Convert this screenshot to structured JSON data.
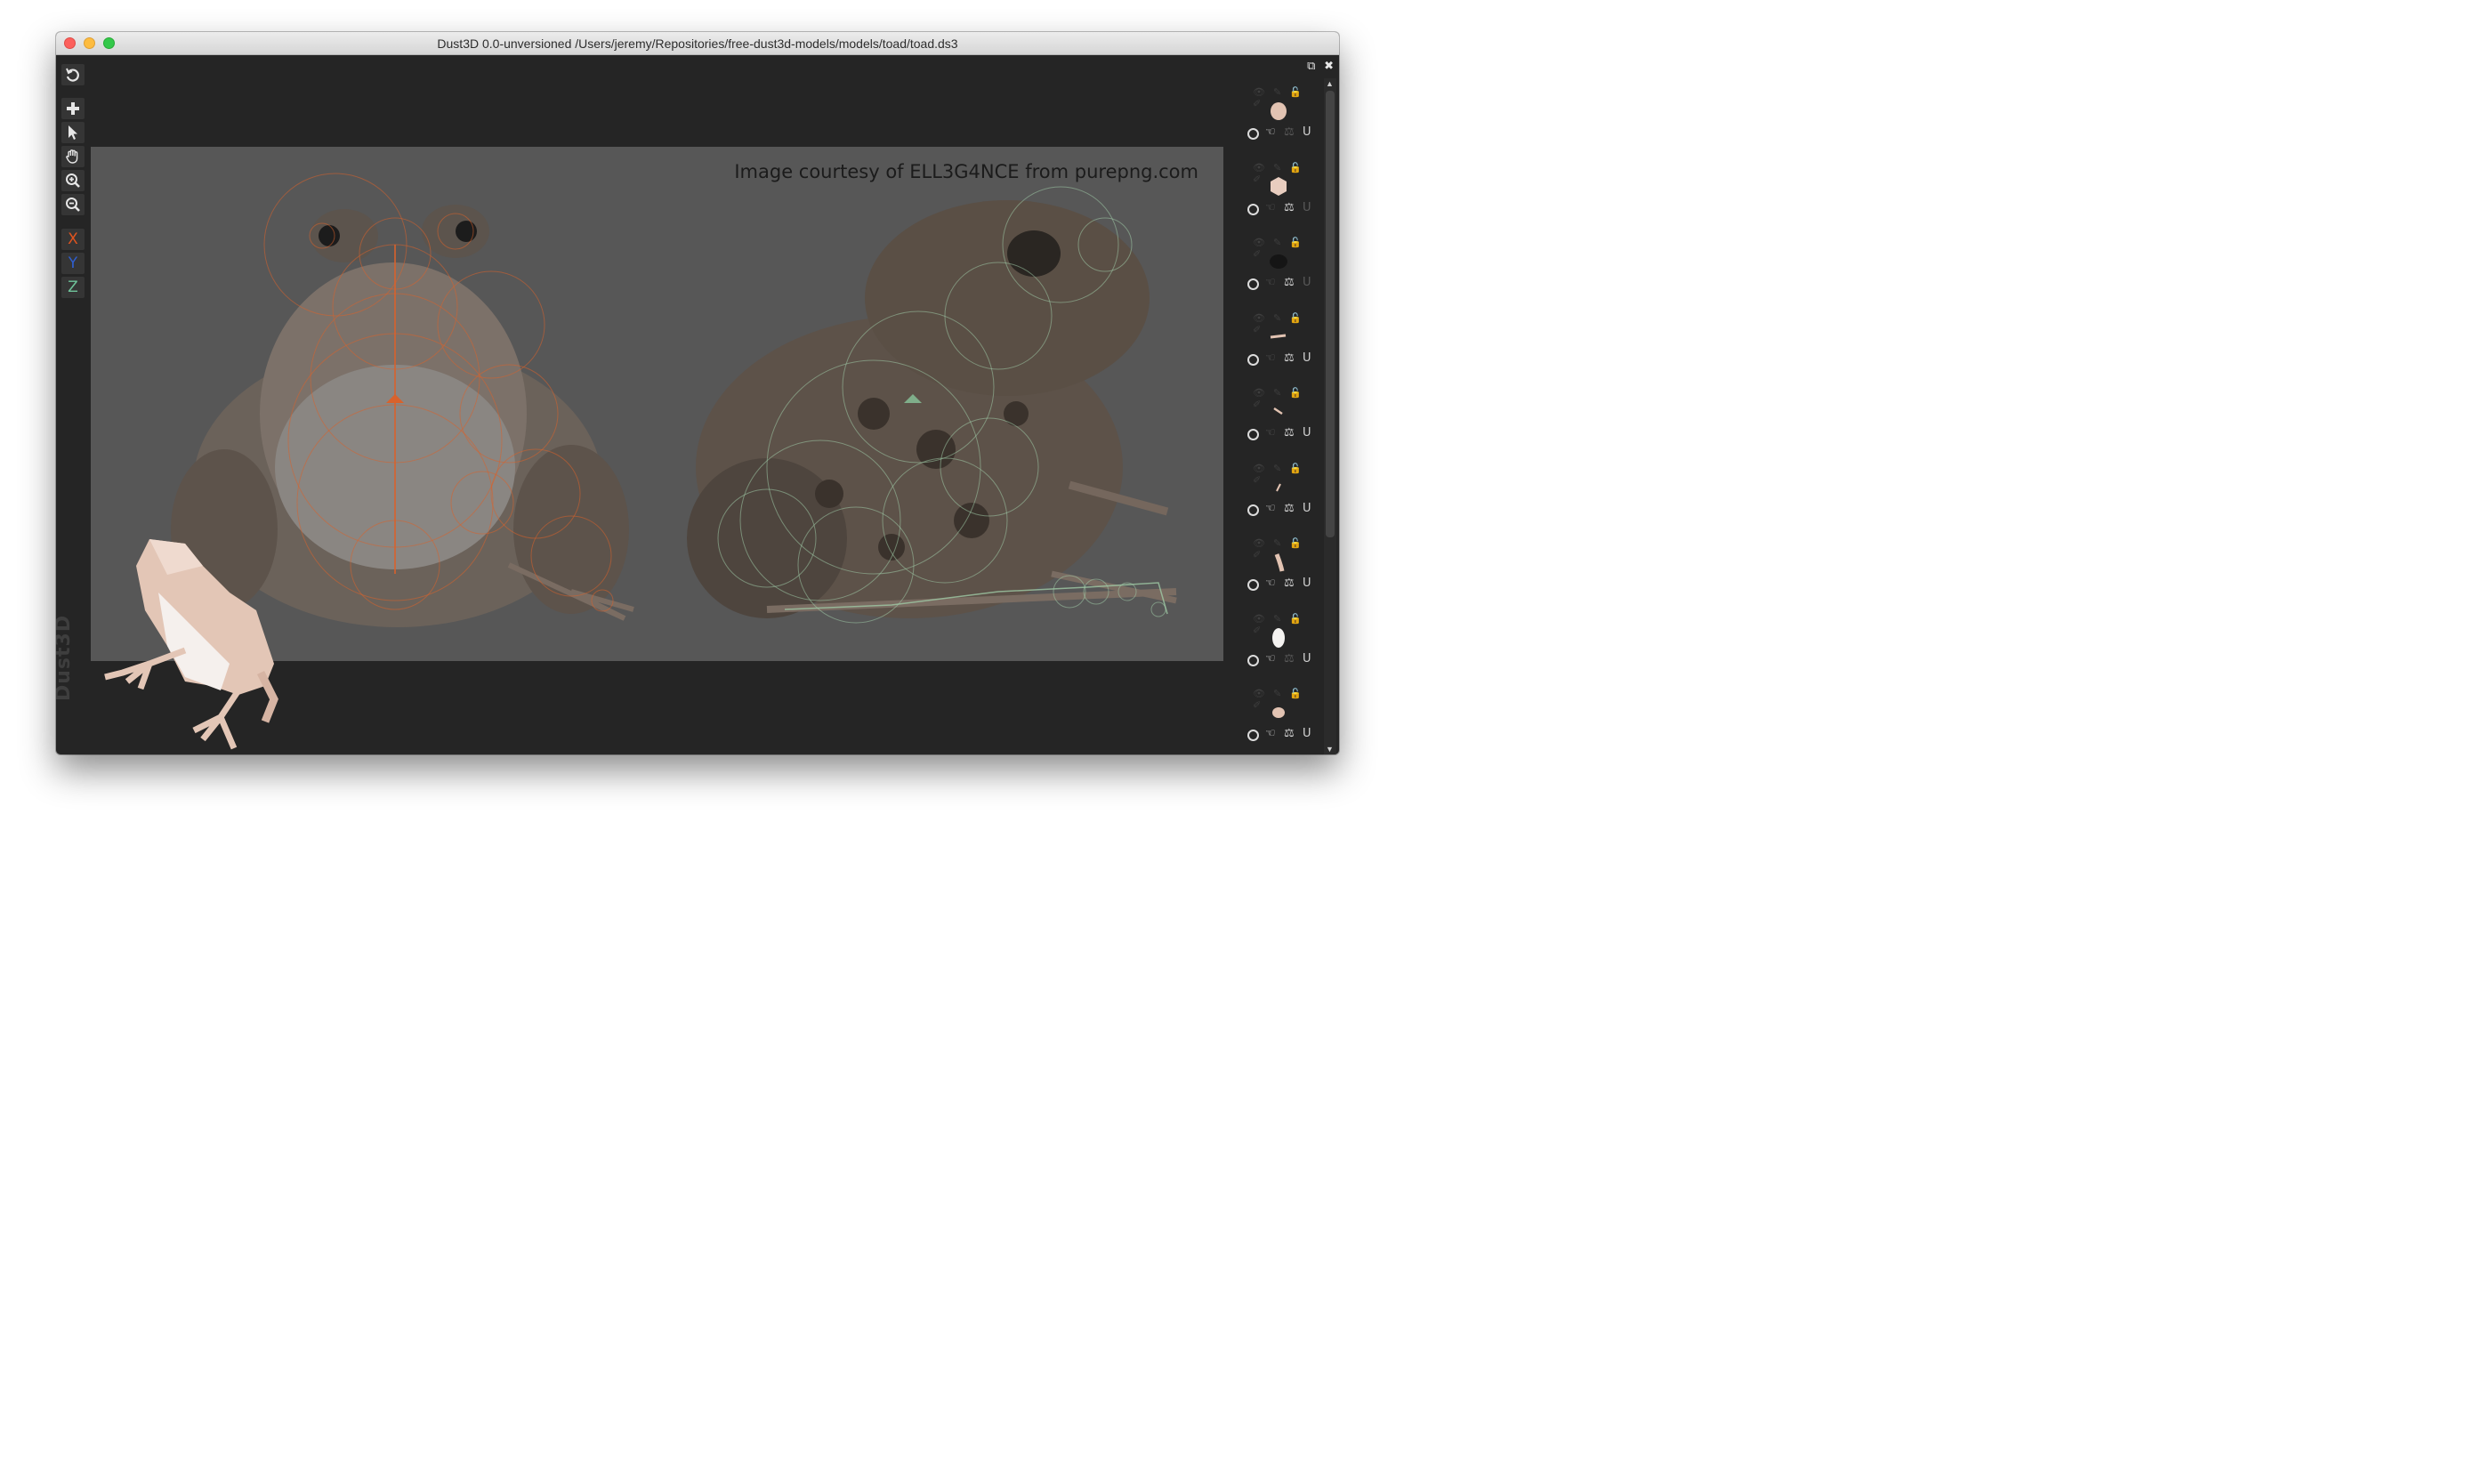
{
  "window": {
    "title": "Dust3D 0.0-unversioned /Users/jeremy/Repositories/free-dust3d-models/models/toad/toad.ds3"
  },
  "toolbar": {
    "undo_icon": "undo-icon",
    "add_icon": "plus-icon",
    "select_icon": "pointer-icon",
    "drag_icon": "hand-icon",
    "zoom_in_icon": "zoom-in-icon",
    "zoom_out_icon": "zoom-out-icon",
    "axis_x": "X",
    "axis_y": "Y",
    "axis_z": "Z",
    "axis_x_color": "#e0541f",
    "axis_y_color": "#2f5fd0",
    "axis_z_color": "#6fc39a"
  },
  "brand": "Dust3D",
  "canvas": {
    "credit": "Image courtesy of ELL3G4NCE from purepng.com",
    "front_node_color": "#d8622c",
    "side_node_color": "#9fc9a5"
  },
  "parts": [
    {
      "thumb": "head-part",
      "mirror": true,
      "balance": false,
      "subdiv": true
    },
    {
      "thumb": "body-part",
      "mirror": false,
      "balance": true,
      "subdiv": false
    },
    {
      "thumb": "eye-part",
      "mirror": false,
      "balance": true,
      "subdiv": false
    },
    {
      "thumb": "arm-part",
      "mirror": false,
      "balance": true,
      "subdiv": true
    },
    {
      "thumb": "finger-part",
      "mirror": false,
      "balance": true,
      "subdiv": true
    },
    {
      "thumb": "toe-part",
      "mirror": true,
      "balance": true,
      "subdiv": true
    },
    {
      "thumb": "leg-part",
      "mirror": true,
      "balance": true,
      "subdiv": true
    },
    {
      "thumb": "belly-part",
      "mirror": true,
      "balance": false,
      "subdiv": true
    },
    {
      "thumb": "foot-part",
      "mirror": true,
      "balance": true,
      "subdiv": true
    }
  ]
}
